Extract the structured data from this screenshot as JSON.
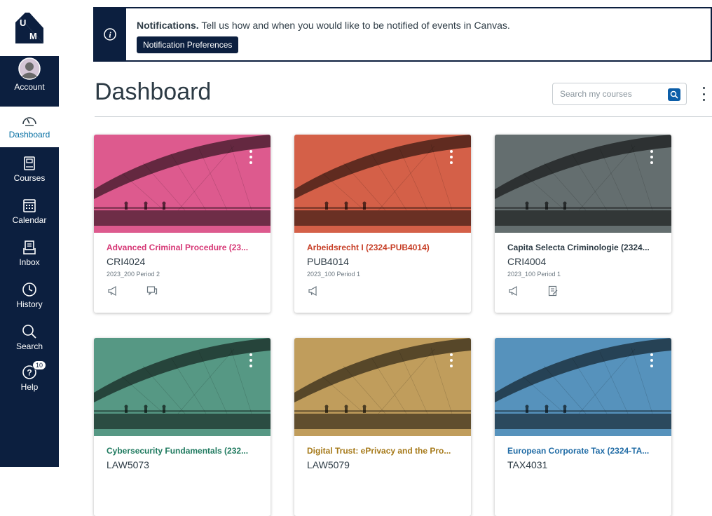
{
  "nav": {
    "logo_top": "U",
    "logo_bottom": "M",
    "items": [
      {
        "label": "Account",
        "icon": "avatar-icon"
      },
      {
        "label": "Dashboard",
        "icon": "speedometer-icon",
        "active": true
      },
      {
        "label": "Courses",
        "icon": "book-icon"
      },
      {
        "label": "Calendar",
        "icon": "calendar-icon"
      },
      {
        "label": "Inbox",
        "icon": "inbox-icon"
      },
      {
        "label": "History",
        "icon": "clock-icon"
      },
      {
        "label": "Search",
        "icon": "search-icon"
      },
      {
        "label": "Help",
        "icon": "help-icon",
        "badge": "10"
      }
    ]
  },
  "notification": {
    "title": "Notifications.",
    "message": "Tell us how and when you would like to be notified of events in Canvas.",
    "button_label": "Notification Preferences"
  },
  "header": {
    "title": "Dashboard",
    "search_placeholder": "Search my courses"
  },
  "courses": [
    {
      "name": "Advanced Criminal Procedure (23...",
      "code": "CRI4024",
      "term": "2023_200 Period 2",
      "color": "#d9447f",
      "name_color": "#d63775",
      "actions": [
        "announcements-icon",
        "discussions-icon"
      ]
    },
    {
      "name": "Arbeidsrecht I (2324-PUB4014)",
      "code": "PUB4014",
      "term": "2023_100 Period 1",
      "color": "#cf4a2f",
      "name_color": "#c73f27",
      "actions": [
        "announcements-icon"
      ]
    },
    {
      "name": "Capita Selecta Criminologie (2324...",
      "code": "CRI4004",
      "term": "2023_100 Period 1",
      "color": "#4f5a5c",
      "name_color": "#2d3b45",
      "actions": [
        "announcements-icon",
        "assignments-icon"
      ]
    },
    {
      "name": "Cybersecurity Fundamentals (232...",
      "code": "LAW5073",
      "term": "",
      "color": "#3f8a74",
      "name_color": "#1f7a5f",
      "actions": []
    },
    {
      "name": "Digital Trust: ePrivacy and the Pro...",
      "code": "LAW5079",
      "term": "",
      "color": "#b89046",
      "name_color": "#a67a1a",
      "actions": []
    },
    {
      "name": "European Corporate Tax (2324-TA...",
      "code": "TAX4031",
      "term": "",
      "color": "#3f83b3",
      "name_color": "#1f6ba5",
      "actions": []
    }
  ],
  "colors": {
    "nav_bg": "#0c1f3f",
    "active_link": "#0770a3",
    "search_button": "#0c5ea8"
  }
}
